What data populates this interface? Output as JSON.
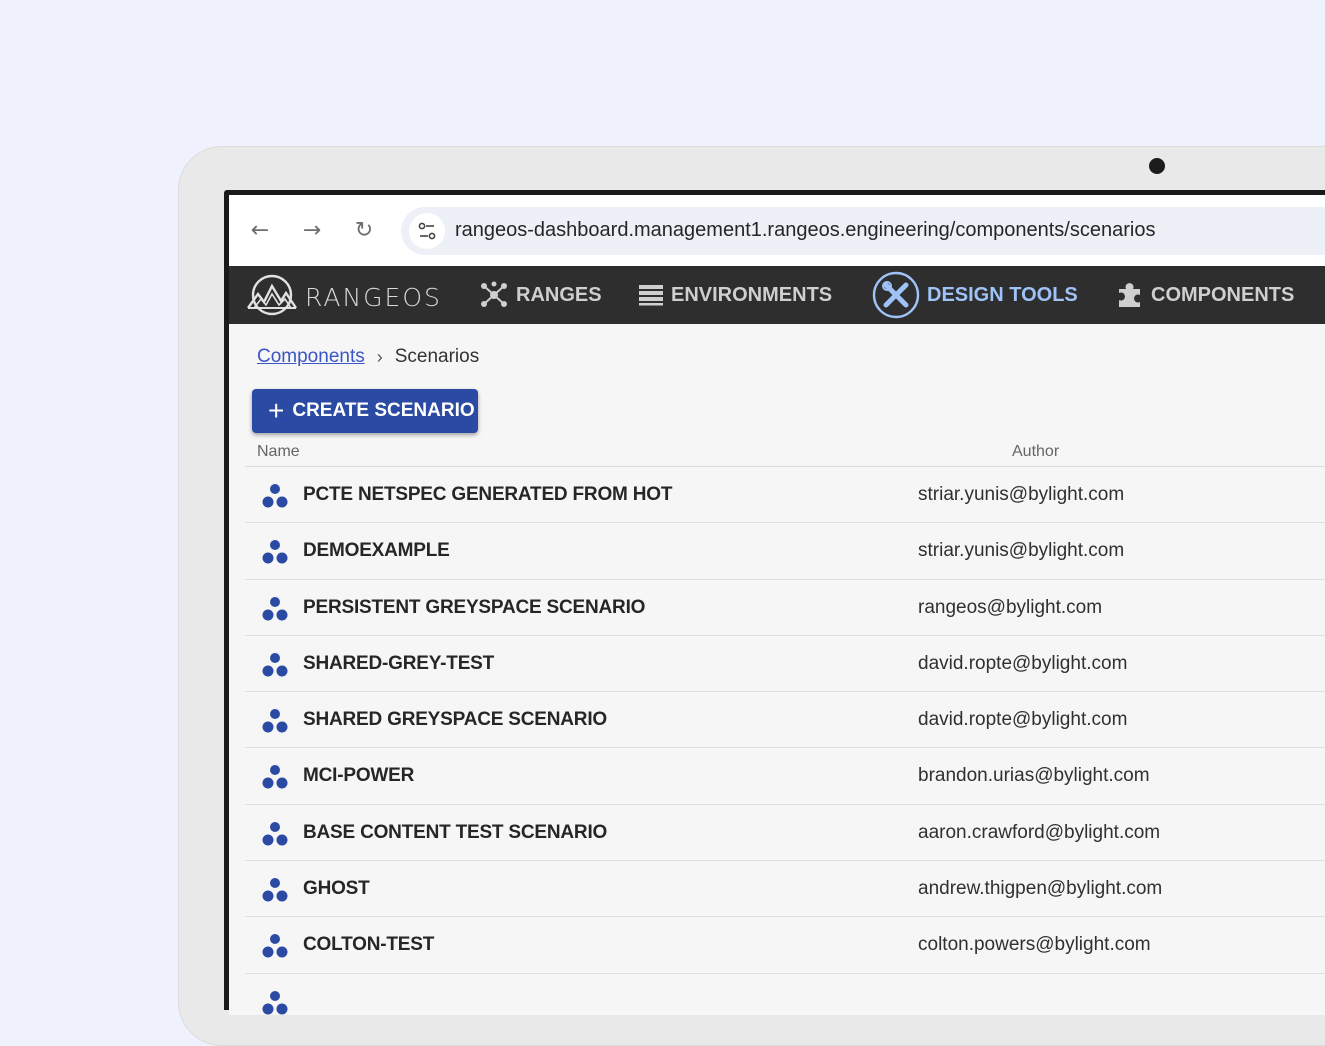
{
  "browser": {
    "url": "rangeos-dashboard.management1.rangeos.engineering/components/scenarios",
    "back_icon": "←",
    "forward_icon": "→",
    "reload_icon": "↻"
  },
  "app": {
    "logo_text": "RANGEOS",
    "nav": [
      {
        "label": "RANGES",
        "icon": "ranges-icon"
      },
      {
        "label": "ENVIRONMENTS",
        "icon": "list-icon"
      },
      {
        "label": "DESIGN TOOLS",
        "icon": "design-tools-icon"
      },
      {
        "label": "COMPONENTS",
        "icon": "puzzle-icon"
      }
    ],
    "active_color": "#9fc3f7",
    "accent_color": "#2b4aa3"
  },
  "breadcrumb": {
    "parent": "Components",
    "separator": "›",
    "current": "Scenarios"
  },
  "create_button": {
    "icon": "+",
    "label": "CREATE SCENARIO"
  },
  "table": {
    "columns": [
      "Name",
      "Author"
    ],
    "rows": [
      {
        "name": "PCTE NETSPEC GENERATED FROM HOT",
        "author": "striar.yunis@bylight.com"
      },
      {
        "name": "DEMOEXAMPLE",
        "author": "striar.yunis@bylight.com"
      },
      {
        "name": "PERSISTENT GREYSPACE SCENARIO",
        "author": "rangeos@bylight.com"
      },
      {
        "name": "SHARED-GREY-TEST",
        "author": "david.ropte@bylight.com"
      },
      {
        "name": "SHARED GREYSPACE SCENARIO",
        "author": "david.ropte@bylight.com"
      },
      {
        "name": "MCI-POWER",
        "author": "brandon.urias@bylight.com"
      },
      {
        "name": "BASE CONTENT TEST SCENARIO",
        "author": "aaron.crawford@bylight.com"
      },
      {
        "name": "GHOST",
        "author": "andrew.thigpen@bylight.com"
      },
      {
        "name": "COLTON-TEST",
        "author": "colton.powers@bylight.com"
      }
    ]
  }
}
